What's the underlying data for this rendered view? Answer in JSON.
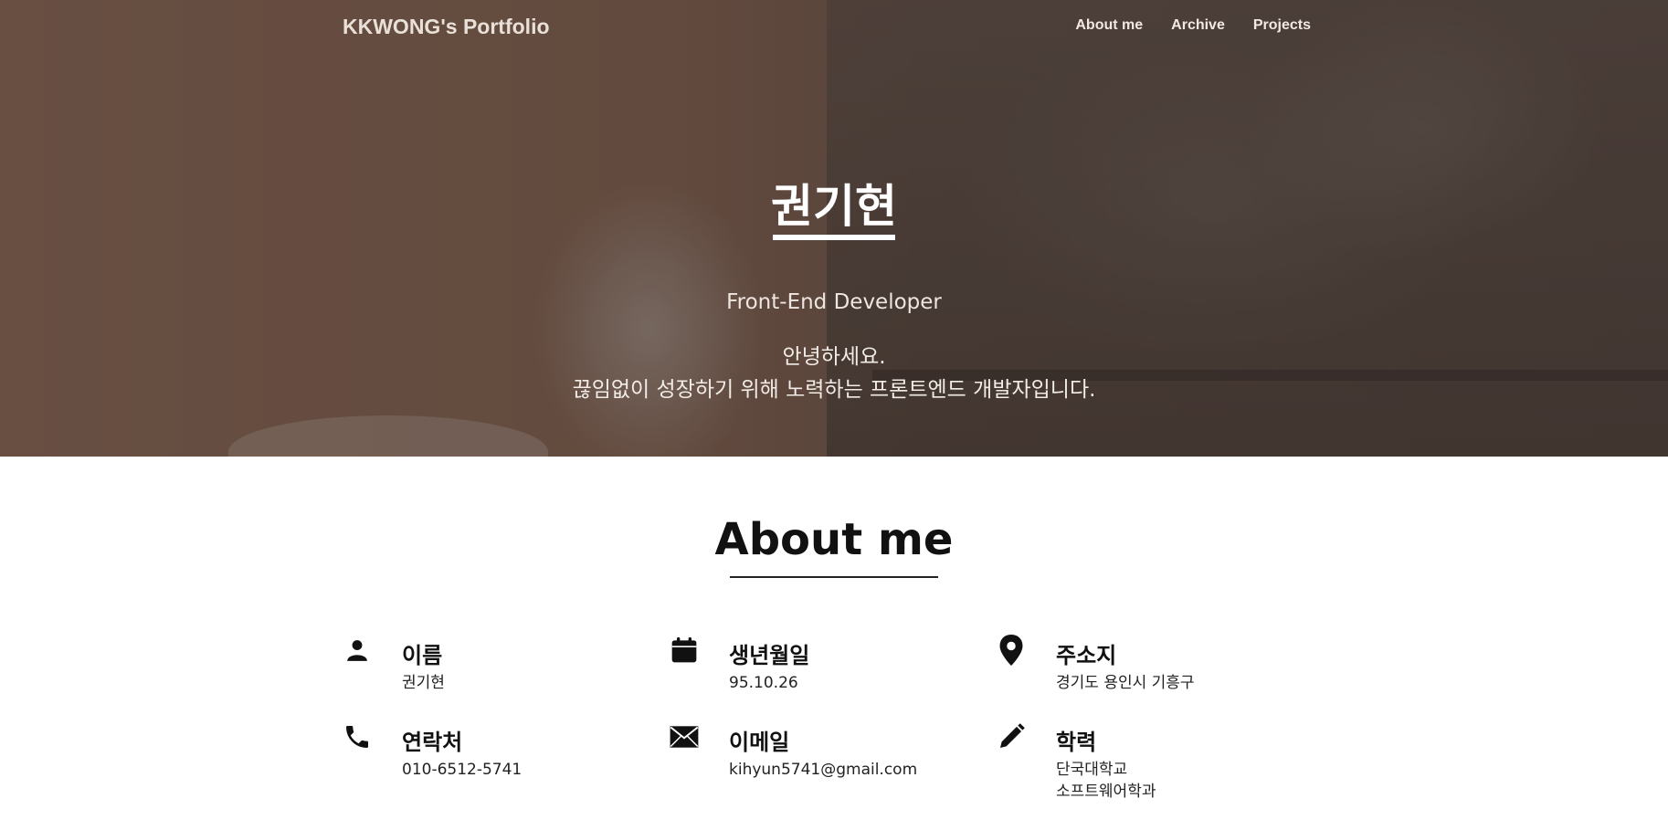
{
  "nav": {
    "brand": "KKWONG's Portfolio",
    "menu": [
      "About me",
      "Archive",
      "Projects"
    ]
  },
  "hero": {
    "name": "권기현",
    "role": "Front-End Developer",
    "intro_line1": "안녕하세요.",
    "intro_line2": "끊임없이 성장하기 위해 노력하는 프론트엔드 개발자입니다."
  },
  "about": {
    "title": "About me",
    "items": [
      {
        "icon": "person-icon",
        "label": "이름",
        "value": "권기현"
      },
      {
        "icon": "calendar-icon",
        "label": "생년월일",
        "value": "95.10.26"
      },
      {
        "icon": "location-pin-icon",
        "label": "주소지",
        "value": "경기도 용인시 기흥구"
      },
      {
        "icon": "phone-icon",
        "label": "연락처",
        "value": "010-6512-5741"
      },
      {
        "icon": "envelope-icon",
        "label": "이메일",
        "value": "kihyun5741@gmail.com"
      },
      {
        "icon": "pencil-icon",
        "label": "학력",
        "value": "단국대학교",
        "value2": "소프트웨어학과"
      }
    ]
  },
  "colors": {
    "hero_bg": "#6b5246",
    "text_dark": "#111111",
    "text_light": "#ffffff"
  }
}
